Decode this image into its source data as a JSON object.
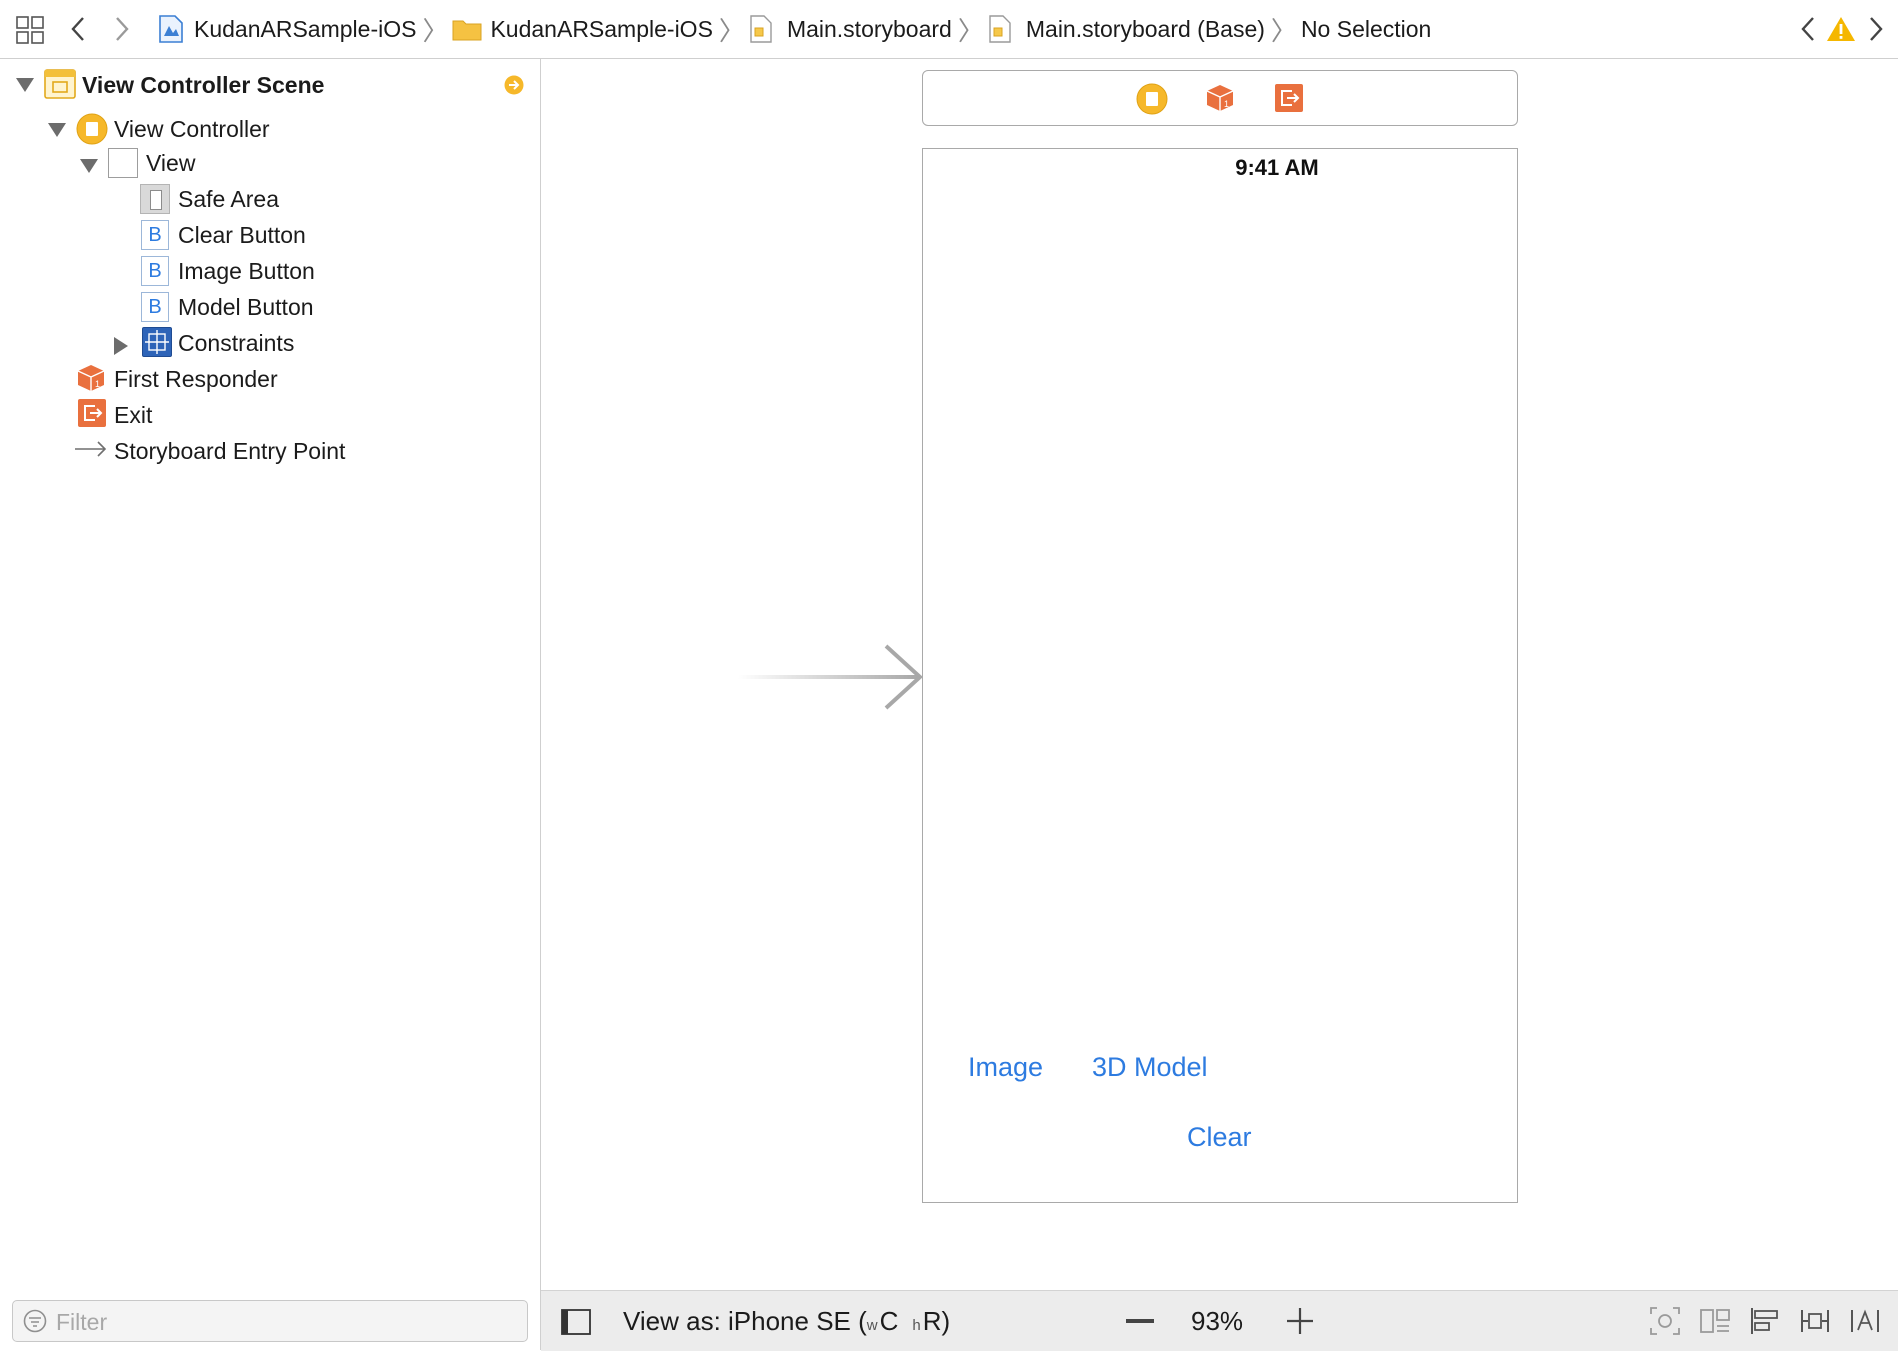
{
  "jumpbar": {
    "crumbs": [
      {
        "label": "KudanARSample-iOS",
        "icon": "project-icon"
      },
      {
        "label": "KudanARSample-iOS",
        "icon": "folder-icon"
      },
      {
        "label": "Main.storyboard",
        "icon": "storyboard-file-icon"
      },
      {
        "label": "Main.storyboard (Base)",
        "icon": "storyboard-file-icon"
      },
      {
        "label": "No Selection",
        "icon": ""
      }
    ],
    "warning_color": "#f5b700"
  },
  "outline": {
    "scene_title": "View Controller Scene",
    "items": [
      {
        "label": "View Controller",
        "icon": "view-controller-icon"
      },
      {
        "label": "View",
        "icon": "view-icon"
      },
      {
        "label": "Safe Area",
        "icon": "safe-area-icon"
      },
      {
        "label": "Clear Button",
        "icon": "button-icon",
        "glyph": "B"
      },
      {
        "label": "Image Button",
        "icon": "button-icon",
        "glyph": "B"
      },
      {
        "label": "Model Button",
        "icon": "button-icon",
        "glyph": "B"
      },
      {
        "label": "Constraints",
        "icon": "constraints-icon"
      },
      {
        "label": "First Responder",
        "icon": "first-responder-icon"
      },
      {
        "label": "Exit",
        "icon": "exit-icon"
      },
      {
        "label": "Storyboard Entry Point",
        "icon": "entry-arrow-icon"
      }
    ],
    "filter_placeholder": "Filter"
  },
  "canvas": {
    "status_time": "9:41 AM",
    "buttons": {
      "image": "Image",
      "model": "3D Model",
      "clear": "Clear"
    },
    "tint_color": "#2d7be0"
  },
  "bottombar": {
    "view_as_prefix": "View as: iPhone SE (",
    "w_small": "w",
    "c_big": "C",
    "h_small": "h",
    "r_big": "R",
    "view_as_suffix": ")",
    "zoom": "93%"
  },
  "colors": {
    "accent_blue": "#2d7be0",
    "vc_yellow": "#f6b82a",
    "responder_orange": "#e9703e"
  }
}
